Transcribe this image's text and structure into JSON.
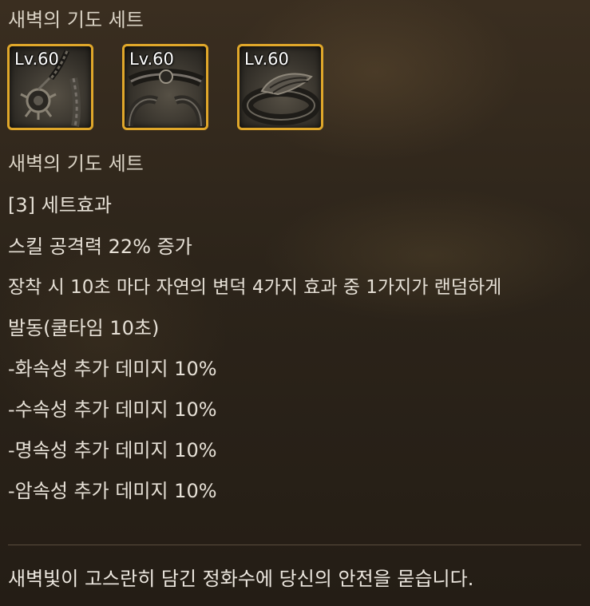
{
  "tooltip": {
    "set_title": "새벽의 기도 세트",
    "items": [
      {
        "level": "Lv.60",
        "icon": "amulet-icon"
      },
      {
        "level": "Lv.60",
        "icon": "bracelet-icon"
      },
      {
        "level": "Lv.60",
        "icon": "ring-icon"
      }
    ],
    "set_name": "새벽의 기도 세트",
    "set_effect_header": "[3] 세트효과",
    "effects": [
      "스킬 공격력 22% 증가",
      "장착 시 10초 마다 자연의 변덕 4가지 효과 중 1가지가 랜덤하게",
      "발동(쿨타임 10초)",
      "-화속성 추가 데미지 10%",
      "-수속성 추가 데미지 10%",
      "-명속성 추가 데미지 10%",
      "-암속성 추가 데미지 10%"
    ],
    "flavor_text": "새벽빛이 고스란히 담긴 정화수에 당신의 안전을 묻습니다."
  },
  "colors": {
    "slot_border": "#e0a72a",
    "background": "#2c241a",
    "text": "#e6e0d6"
  }
}
